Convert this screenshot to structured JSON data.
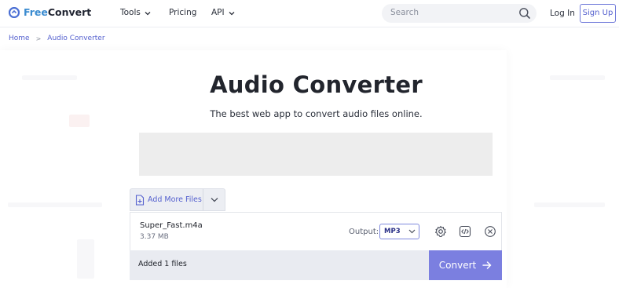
{
  "header": {
    "logo": {
      "part1": "Free",
      "part2": "Convert"
    },
    "nav": [
      {
        "label": "Tools",
        "has_dropdown": true
      },
      {
        "label": "Pricing",
        "has_dropdown": false
      },
      {
        "label": "API",
        "has_dropdown": true
      }
    ],
    "search": {
      "placeholder": "Search",
      "icon": "search-icon"
    },
    "login_label": "Log In",
    "signup_label": "Sign Up"
  },
  "breadcrumb": {
    "home": "Home",
    "separator": ">",
    "current": "Audio Converter"
  },
  "main": {
    "title": "Audio Converter",
    "subtitle": "The best web app to convert audio files online.",
    "add_more_label": "Add More Files",
    "file": {
      "name": "Super_Fast.m4a",
      "size": "3.37 MB",
      "output_label": "Output:",
      "output_value": "MP3"
    },
    "added_text": "Added 1 files",
    "convert_label": "Convert"
  },
  "colors": {
    "brand_blue": "#3a8bd0",
    "accent": "#5561cf",
    "convert_bg": "#7b7fe0"
  }
}
